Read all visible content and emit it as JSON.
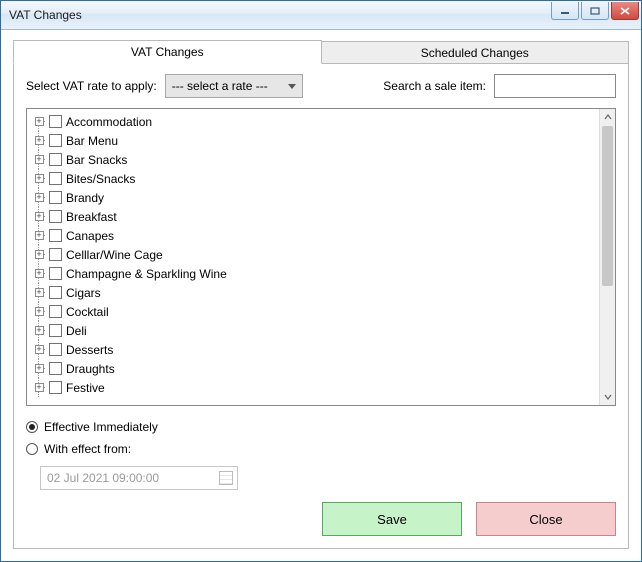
{
  "window": {
    "title": "VAT Changes"
  },
  "tabs": [
    {
      "label": "VAT Changes",
      "active": true
    },
    {
      "label": "Scheduled Changes",
      "active": false
    }
  ],
  "controls": {
    "rate_label": "Select VAT rate to apply:",
    "rate_selected": "--- select a rate ---",
    "search_label": "Search a sale item:",
    "search_value": ""
  },
  "tree_items": [
    "Accommodation",
    "Bar Menu",
    "Bar Snacks",
    "Bites/Snacks",
    "Brandy",
    "Breakfast",
    "Canapes",
    "Celllar/Wine Cage",
    "Champagne & Sparkling Wine",
    "Cigars",
    "Cocktail",
    "Deli",
    "Desserts",
    "Draughts",
    "Festive"
  ],
  "effective": {
    "immediate_label": "Effective Immediately",
    "from_label": "With effect from:",
    "selected": "immediate",
    "datetime_value": "02  Jul  2021      09:00:00"
  },
  "buttons": {
    "save": "Save",
    "close": "Close"
  }
}
